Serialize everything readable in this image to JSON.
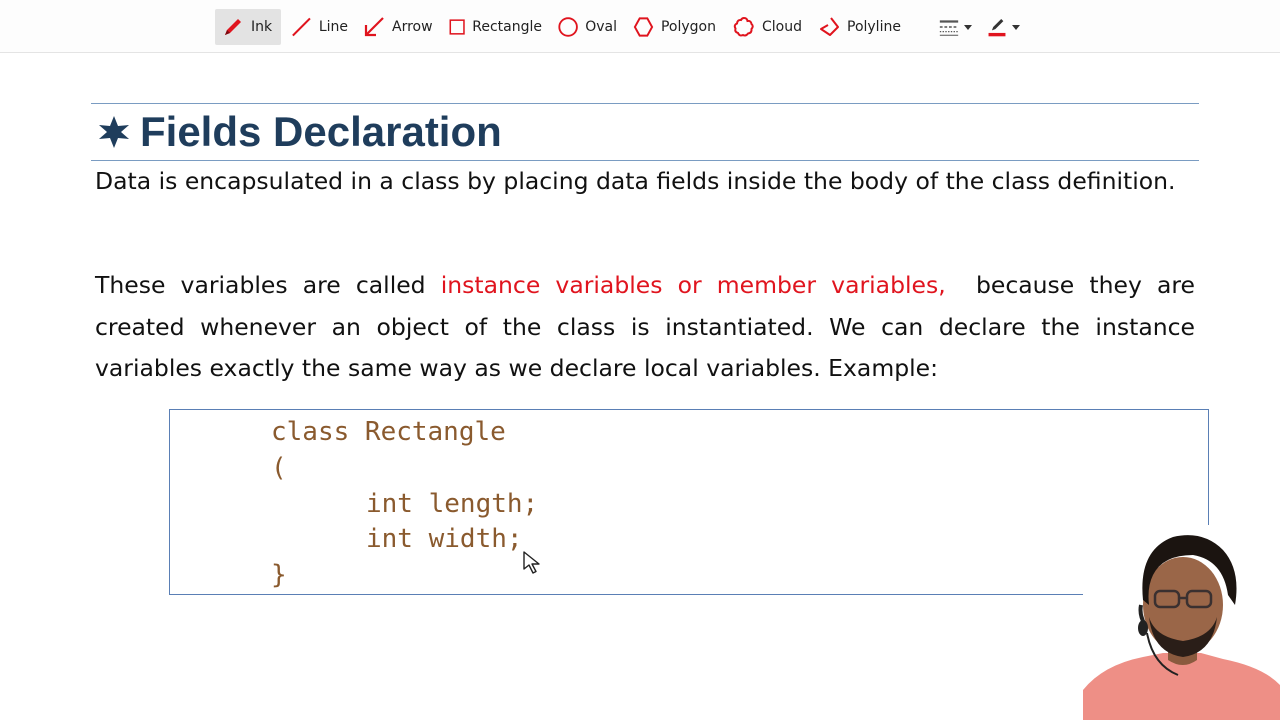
{
  "toolbar": {
    "tools": [
      {
        "label": "Ink",
        "icon": "pen-icon",
        "active": true
      },
      {
        "label": "Line",
        "icon": "line-icon"
      },
      {
        "label": "Arrow",
        "icon": "arrow-icon"
      },
      {
        "label": "Rectangle",
        "icon": "rectangle-icon"
      },
      {
        "label": "Oval",
        "icon": "oval-icon"
      },
      {
        "label": "Polygon",
        "icon": "polygon-icon"
      },
      {
        "label": "Cloud",
        "icon": "cloud-icon"
      },
      {
        "label": "Polyline",
        "icon": "polyline-icon"
      }
    ],
    "accent_color": "#e0141e"
  },
  "slide": {
    "title": "Fields Declaration",
    "para1": "Data is encapsulated in a class by placing data fields inside the body of the class definition.",
    "para2_before": "These variables are called ",
    "para2_highlight": "instance variables or member variables,",
    "para2_after": "  because they are created whenever an object of the class is instantiated. We can declare the instance variables exactly the same way as we declare local variables. Example:",
    "code": {
      "line1": "class Rectangle",
      "line2": "(",
      "line3": "int length;",
      "line4": "int width;",
      "line5": "}"
    },
    "colors": {
      "title": "#1f3d5c",
      "highlight": "#e0141e",
      "code": "#8a5a2e",
      "rule": "#7a9cc2"
    }
  }
}
